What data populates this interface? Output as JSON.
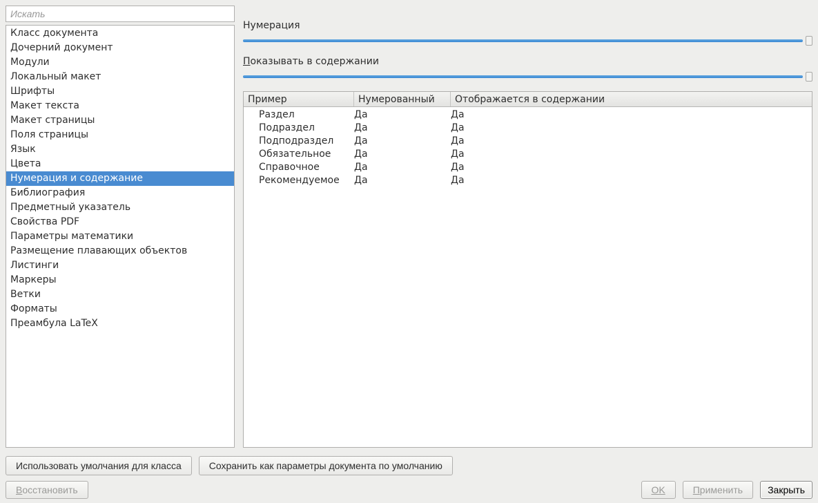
{
  "search_placeholder": "Искать",
  "sidebar": {
    "selected_index": 10,
    "items": [
      "Класс документа",
      "Дочерний документ",
      "Модули",
      "Локальный макет",
      "Шрифты",
      "Макет текста",
      "Макет страницы",
      "Поля страницы",
      "Язык",
      "Цвета",
      "Нумерация и содержание",
      "Библиография",
      "Предметный указатель",
      "Свойства PDF",
      "Параметры математики",
      "Размещение плавающих объектов",
      "Листинги",
      "Маркеры",
      "Ветки",
      "Форматы",
      "Преамбула LaTeX"
    ]
  },
  "panel": {
    "numbering_label": "Нумерация",
    "show_in_toc_label_pre": "П",
    "show_in_toc_label_rest": "оказывать в содержании",
    "table": {
      "headers": [
        "Пример",
        "Нумерованный",
        "Отображается в содержании"
      ],
      "rows": [
        {
          "name": "Раздел",
          "numbered": "Да",
          "intoc": "Да"
        },
        {
          "name": "Подраздел",
          "numbered": "Да",
          "intoc": "Да"
        },
        {
          "name": "Подподраздел",
          "numbered": "Да",
          "intoc": "Да"
        },
        {
          "name": "Обязательное",
          "numbered": "Да",
          "intoc": "Да"
        },
        {
          "name": "Справочное",
          "numbered": "Да",
          "intoc": "Да"
        },
        {
          "name": "Рекомендуемое",
          "numbered": "Да",
          "intoc": "Да"
        }
      ]
    }
  },
  "buttons": {
    "use_class_defaults": "Использовать умолчания для класса",
    "save_as_defaults": "Сохранить как параметры документа по умолчанию",
    "restore_pre": "В",
    "restore_rest": "осстановить",
    "ok": "OK",
    "apply_pre": "П",
    "apply_rest": "рименить",
    "close": "Закрыть"
  }
}
